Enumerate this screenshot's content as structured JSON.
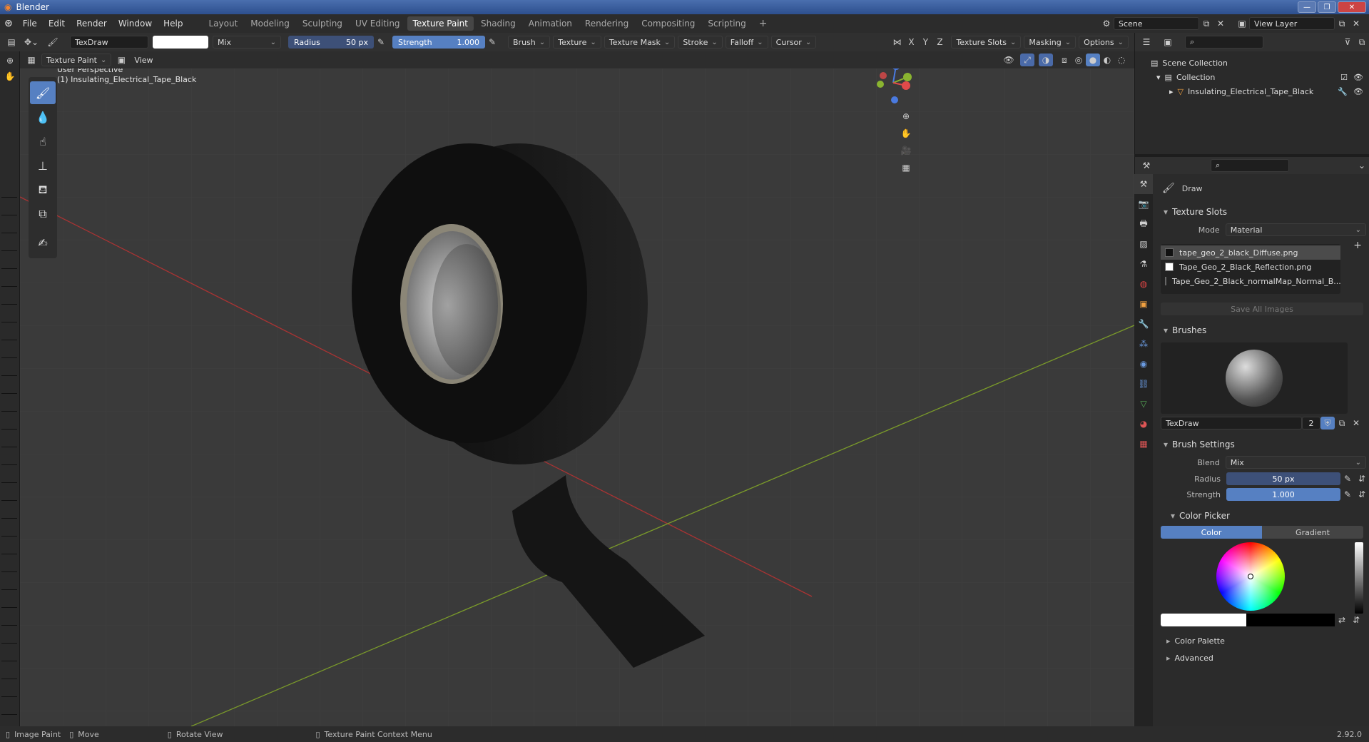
{
  "window": {
    "title": "Blender"
  },
  "menu": [
    "File",
    "Edit",
    "Render",
    "Window",
    "Help"
  ],
  "workspaces": [
    {
      "label": "Layout",
      "active": false
    },
    {
      "label": "Modeling",
      "active": false
    },
    {
      "label": "Sculpting",
      "active": false
    },
    {
      "label": "UV Editing",
      "active": false
    },
    {
      "label": "Texture Paint",
      "active": true
    },
    {
      "label": "Shading",
      "active": false
    },
    {
      "label": "Animation",
      "active": false
    },
    {
      "label": "Rendering",
      "active": false
    },
    {
      "label": "Compositing",
      "active": false
    },
    {
      "label": "Scripting",
      "active": false
    }
  ],
  "scene": {
    "name": "Scene",
    "view_layer": "View Layer"
  },
  "tool_header": {
    "brush_name": "TexDraw",
    "blend": "Mix",
    "radius_label": "Radius",
    "radius_value": "50 px",
    "strength_label": "Strength",
    "strength_value": "1.000",
    "menus": [
      "Brush",
      "Texture",
      "Texture Mask",
      "Stroke",
      "Falloff",
      "Cursor"
    ],
    "axes": [
      "X",
      "Y",
      "Z"
    ],
    "right_menus": [
      "Texture Slots",
      "Masking",
      "Options"
    ]
  },
  "view_header": {
    "mode": "Texture Paint",
    "view": "View"
  },
  "viewport": {
    "perspective": "User Perspective",
    "object_label": "(1) Insulating_Electrical_Tape_Black"
  },
  "gizmo": {
    "x": "X",
    "y": "Y",
    "z": "Z"
  },
  "outliner": {
    "scene_collection": "Scene Collection",
    "collection": "Collection",
    "object": "Insulating_Electrical_Tape_Black"
  },
  "properties": {
    "tool_name": "Draw",
    "texture_slots": {
      "title": "Texture Slots",
      "mode_label": "Mode",
      "mode_value": "Material",
      "slots": [
        {
          "name": "tape_geo_2_black_Diffuse.png",
          "swatch": "#111111"
        },
        {
          "name": "Tape_Geo_2_Black_Reflection.png",
          "swatch": "#ffffff"
        },
        {
          "name": "Tape_Geo_2_Black_normalMap_Normal_B...",
          "swatch": "#8f8fe8"
        }
      ],
      "save_all": "Save All Images"
    },
    "brushes": {
      "title": "Brushes",
      "name": "TexDraw",
      "users": "2"
    },
    "brush_settings": {
      "title": "Brush Settings",
      "blend_label": "Blend",
      "blend_value": "Mix",
      "radius_label": "Radius",
      "radius_value": "50 px",
      "strength_label": "Strength",
      "strength_value": "1.000"
    },
    "color_picker": {
      "title": "Color Picker",
      "tab_color": "Color",
      "tab_gradient": "Gradient"
    },
    "color_palette": "Color Palette",
    "advanced": "Advanced"
  },
  "statusbar": {
    "image_paint": "Image Paint",
    "move": "Move",
    "rotate": "Rotate View",
    "context": "Texture Paint Context Menu",
    "version": "2.92.0"
  },
  "colors": {
    "accent": "#5680c2",
    "viewport_bg": "#3a3a3a",
    "panel_bg": "#2b2b2b"
  }
}
